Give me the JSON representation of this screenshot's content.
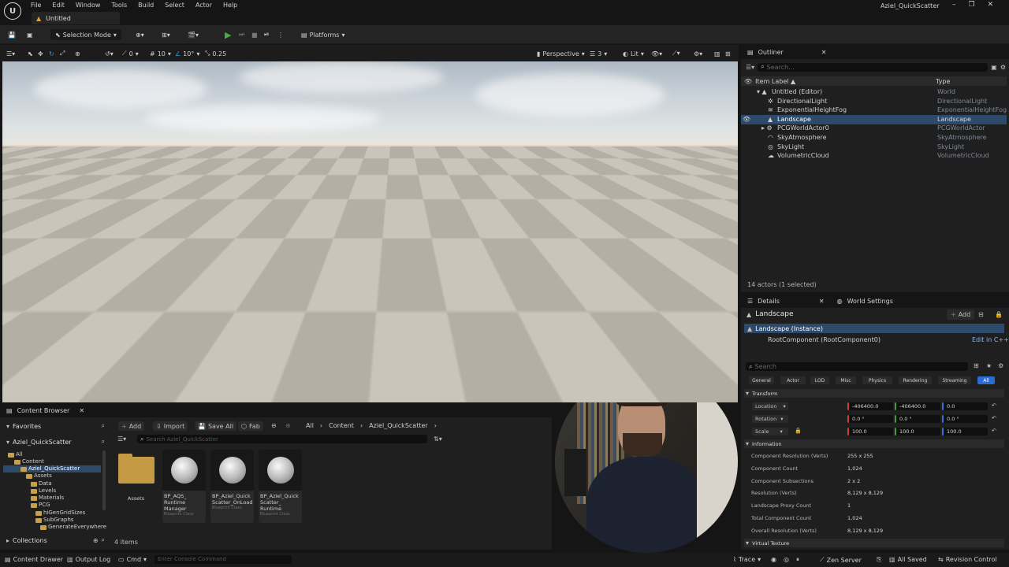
{
  "app": {
    "title": "Aziel_QuickScatter",
    "doc_tab": "Untitled",
    "logo_letter": "U",
    "menu": [
      "File",
      "Edit",
      "Window",
      "Tools",
      "Build",
      "Select",
      "Actor",
      "Help"
    ],
    "window_controls": [
      "–",
      "❐",
      "✕"
    ]
  },
  "toolbar": {
    "selection_mode": "Selection Mode",
    "platforms": "Platforms"
  },
  "viewport_toolbar": {
    "rotation_snap": "0",
    "grid_snap": "10",
    "angle_snap": "10°",
    "scale_snap": "0.25",
    "view_mode": "Perspective",
    "camera_speed": "3",
    "lighting": "Lit"
  },
  "outliner": {
    "tab": "Outliner",
    "search_placeholder": "Search...",
    "col_label": "Item Label ▲",
    "col_type": "Type",
    "rows": [
      {
        "label": "Untitled (Editor)",
        "type": "World"
      },
      {
        "label": "DirectionalLight",
        "type": "DirectionalLight"
      },
      {
        "label": "ExponentialHeightFog",
        "type": "ExponentialHeightFog"
      },
      {
        "label": "Landscape",
        "type": "Landscape"
      },
      {
        "label": "PCGWorldActor0",
        "type": "PCGWorldActor"
      },
      {
        "label": "SkyAtmosphere",
        "type": "SkyAtmosphere"
      },
      {
        "label": "SkyLight",
        "type": "SkyLight"
      },
      {
        "label": "VolumetricCloud",
        "type": "VolumetricCloud"
      }
    ],
    "footer": "14 actors (1 selected)"
  },
  "details": {
    "tab": "Details",
    "tab2": "World Settings",
    "actor_name": "Landscape",
    "add_label": "Add",
    "instance": "Landscape (Instance)",
    "root_component": "RootComponent (RootComponent0)",
    "edit_cpp": "Edit in C++",
    "search_placeholder": "Search",
    "filters": [
      "General",
      "Actor",
      "LOD",
      "Misc",
      "Physics",
      "Rendering",
      "Streaming",
      "All"
    ],
    "transform_header": "Transform",
    "location_label": "Location",
    "location": [
      "-406400.0",
      "-406400.0",
      "0.0"
    ],
    "rotation_label": "Rotation",
    "rotation": [
      "0.0 °",
      "0.0 °",
      "0.0 °"
    ],
    "scale_label": "Scale",
    "scale": [
      "100.0",
      "100.0",
      "100.0"
    ],
    "info_header": "Information",
    "info": [
      {
        "label": "Component Resolution (Verts)",
        "value": "255 x 255"
      },
      {
        "label": "Component Count",
        "value": "1,024"
      },
      {
        "label": "Component Subsections",
        "value": "2 x 2"
      },
      {
        "label": "Resolution (Verts)",
        "value": "8,129 x 8,129"
      },
      {
        "label": "Landscape Proxy Count",
        "value": "1"
      },
      {
        "label": "Total Component Count",
        "value": "1,024"
      },
      {
        "label": "Overall Resolution (Verts)",
        "value": "8,129 x 8,129"
      }
    ],
    "virtual_texture_header": "Virtual Texture"
  },
  "content_browser": {
    "tab": "Content Browser",
    "add": "Add",
    "import": "Import",
    "save_all": "Save All",
    "fab": "Fab",
    "path": [
      "All",
      "Content",
      "Aziel_QuickScatter"
    ],
    "favorites": "Favorites",
    "project": "Aziel_QuickScatter",
    "search_placeholder": "Search Aziel_QuickScatter",
    "tree": [
      "All",
      "Content",
      "Aziel_QuickScatter",
      "Assets",
      "Data",
      "Levels",
      "Materials",
      "PCG",
      "hiGenGridSizes",
      "SubGraphs",
      "GenerateEverywhere"
    ],
    "collections": "Collections",
    "item_count": "4 items",
    "assets": [
      {
        "name": "Assets",
        "kind": "folder",
        "sub": ""
      },
      {
        "name": "BP_AQS_ Runtime Manager",
        "kind": "blueprint",
        "sub": "Blueprint Class"
      },
      {
        "name": "BP_Aziel_Quick Scatter_OnLoad",
        "kind": "blueprint",
        "sub": "Blueprint Class"
      },
      {
        "name": "BP_Aziel_Quick Scatter_ Runtime",
        "kind": "blueprint",
        "sub": "Blueprint Class"
      }
    ]
  },
  "statusbar": {
    "content_drawer": "Content Drawer",
    "output_log": "Output Log",
    "cmd": "Cmd",
    "console_placeholder": "Enter Console Command",
    "trace": "Trace",
    "zen": "Zen Server",
    "saved": "All Saved",
    "revision": "Revision Control"
  },
  "colors": {
    "accent": "#2b6bd6",
    "selection": "#2e4a6b",
    "play": "#43b043"
  }
}
